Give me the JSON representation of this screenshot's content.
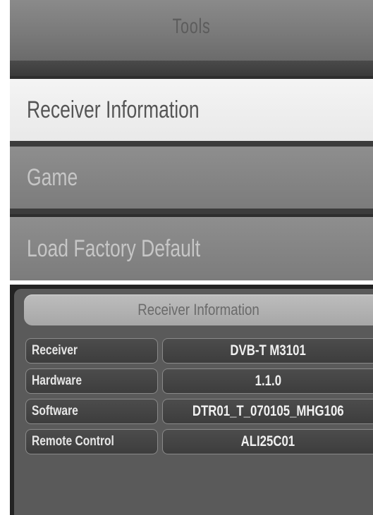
{
  "tools_menu": {
    "title": "Tools",
    "items": [
      {
        "label": "Receiver Information",
        "selected": true
      },
      {
        "label": "Game",
        "selected": false
      },
      {
        "label": "Load Factory Default",
        "selected": false
      }
    ]
  },
  "receiver_info": {
    "title": "Receiver Information",
    "rows": [
      {
        "label": "Receiver",
        "value": "DVB-T M3101"
      },
      {
        "label": "Hardware",
        "value": "1.1.0"
      },
      {
        "label": "Software",
        "value": "DTR01_T_070105_MHG106"
      },
      {
        "label": "Remote Control",
        "value": "ALI25C01"
      }
    ]
  },
  "colors": {
    "selected_background": "#efefef",
    "menu_item_background": "#858585",
    "panel_background": "#2e2e2e"
  }
}
